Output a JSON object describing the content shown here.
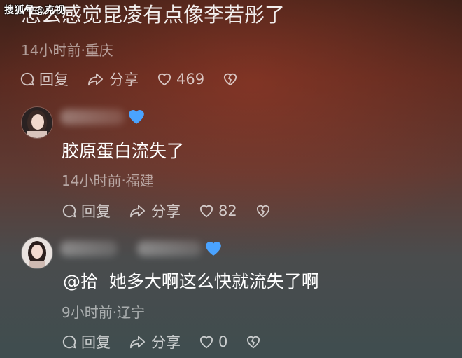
{
  "watermark": "搜狐号@克视",
  "comments": [
    {
      "text": "怎么感觉昆凌有点像李若彤了",
      "meta": "14小时前·重庆",
      "reply_label": "回复",
      "share_label": "分享",
      "likes": "469"
    },
    {
      "text": "胶原蛋白流失了",
      "meta": "14小时前·福建",
      "reply_label": "回复",
      "share_label": "分享",
      "likes": "82"
    },
    {
      "text": "@拾  她多大啊这么快就流失了啊",
      "meta": "9小时前·辽宁",
      "reply_label": "回复",
      "share_label": "分享",
      "likes": "0"
    }
  ],
  "colors": {
    "badge_blue": "#4aa3ff",
    "meta_gray": "#b9a9a6"
  }
}
